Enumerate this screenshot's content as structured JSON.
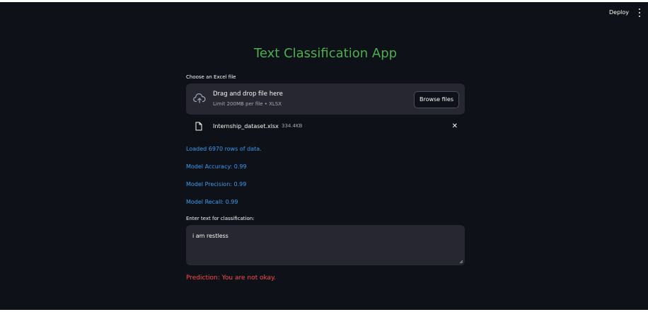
{
  "header": {
    "deploy_label": "Deploy",
    "menu_icon": "kebab-menu-icon"
  },
  "app": {
    "title": "Text Classification App",
    "title_color": "#4caf50"
  },
  "uploader": {
    "label": "Choose an Excel file",
    "dropzone_title": "Drag and drop file here",
    "dropzone_sub": "Limit 200MB per file • XLSX",
    "browse_label": "Browse files",
    "icon": "cloud-upload-icon"
  },
  "file": {
    "name": "Internship_dataset.xlsx",
    "size": "334.4KB",
    "icon": "file-icon",
    "close_glyph": "✕"
  },
  "messages": {
    "loaded": "Loaded 6970 rows of data.",
    "accuracy": "Model Accuracy: 0.99",
    "precision": "Model Precision: 0.99",
    "recall": "Model Recall: 0.99",
    "info_color": "#3d9df3"
  },
  "input": {
    "label": "Enter text for classification:",
    "value": "i am restless"
  },
  "prediction": {
    "text": "Prediction: You are not okay.",
    "color": "#ff4b4b"
  }
}
